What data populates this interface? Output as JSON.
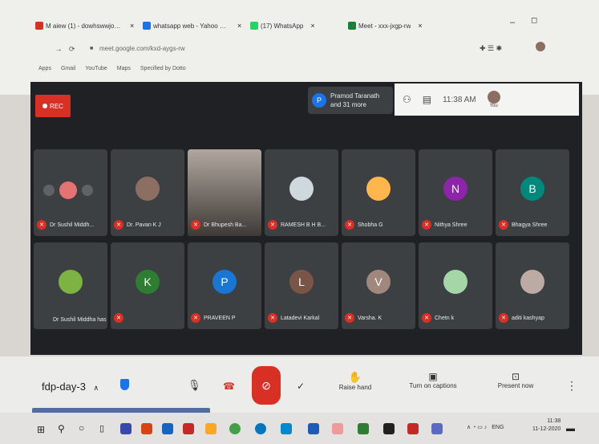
{
  "browser": {
    "tabs": [
      {
        "label": "M aiew (1) - dowhswwjouzpto",
        "color": "#d93025"
      },
      {
        "label": "whatsapp web - Yahoo Sea",
        "color": "#1a73e8"
      },
      {
        "label": "(17) WhatsApp",
        "color": "#25d366"
      },
      {
        "label": "Meet - xxx-jxgp-rw",
        "color": "#188038"
      }
    ],
    "address": "meet.google.com/kxd-aygs-rw",
    "bookmarks": [
      "Apps",
      "Gmail",
      "YouTube",
      "Maps",
      "Specified by Dotto"
    ]
  },
  "meeting": {
    "rec_label": "REC",
    "pinned": {
      "initial": "P",
      "name": "Pramod Taranath",
      "more": "and 31 more"
    },
    "clock": "11:38 AM",
    "you_label": "You",
    "participants": [
      {
        "name": "Dr Sushil Middh...",
        "type": "dots"
      },
      {
        "name": "Dr. Pavan K J",
        "type": "photo",
        "color": "#8d6e63"
      },
      {
        "name": "Dr Bhupesh Ba...",
        "type": "video"
      },
      {
        "name": "RAMESH B H B...",
        "type": "photo",
        "color": "#cfd8dc"
      },
      {
        "name": "Shobha G",
        "type": "photo",
        "color": "#ffb74d"
      },
      {
        "name": "Nithya Shree",
        "type": "initial",
        "initial": "N",
        "color": "#8e24aa"
      },
      {
        "name": "Bhagya Shree",
        "type": "initial",
        "initial": "B",
        "color": "#00897b"
      },
      {
        "name": "Dr Sushil Middha has left the meeting",
        "type": "photo",
        "color": "#7cb342",
        "left": true
      },
      {
        "name": "",
        "type": "initial",
        "initial": "K",
        "color": "#2e7d32"
      },
      {
        "name": "PRAVEEN P",
        "type": "initial",
        "initial": "P",
        "color": "#1976d2"
      },
      {
        "name": "Latadevi Karkal",
        "type": "initial",
        "initial": "L",
        "color": "#795548"
      },
      {
        "name": "Varsha. K",
        "type": "initial",
        "initial": "V",
        "color": "#a1887f"
      },
      {
        "name": "Chetn k",
        "type": "photo",
        "color": "#a5d6a7"
      },
      {
        "name": "aditi kashyap",
        "type": "photo",
        "color": "#bcaaa4"
      }
    ]
  },
  "controls": {
    "meet_code": "fdp-day-3",
    "raise_hand": "Raise hand",
    "captions": "Turn on captions",
    "present": "Present now"
  },
  "taskbar": {
    "lang": "ENG",
    "time": "11:38",
    "date": "11-12-2020"
  }
}
